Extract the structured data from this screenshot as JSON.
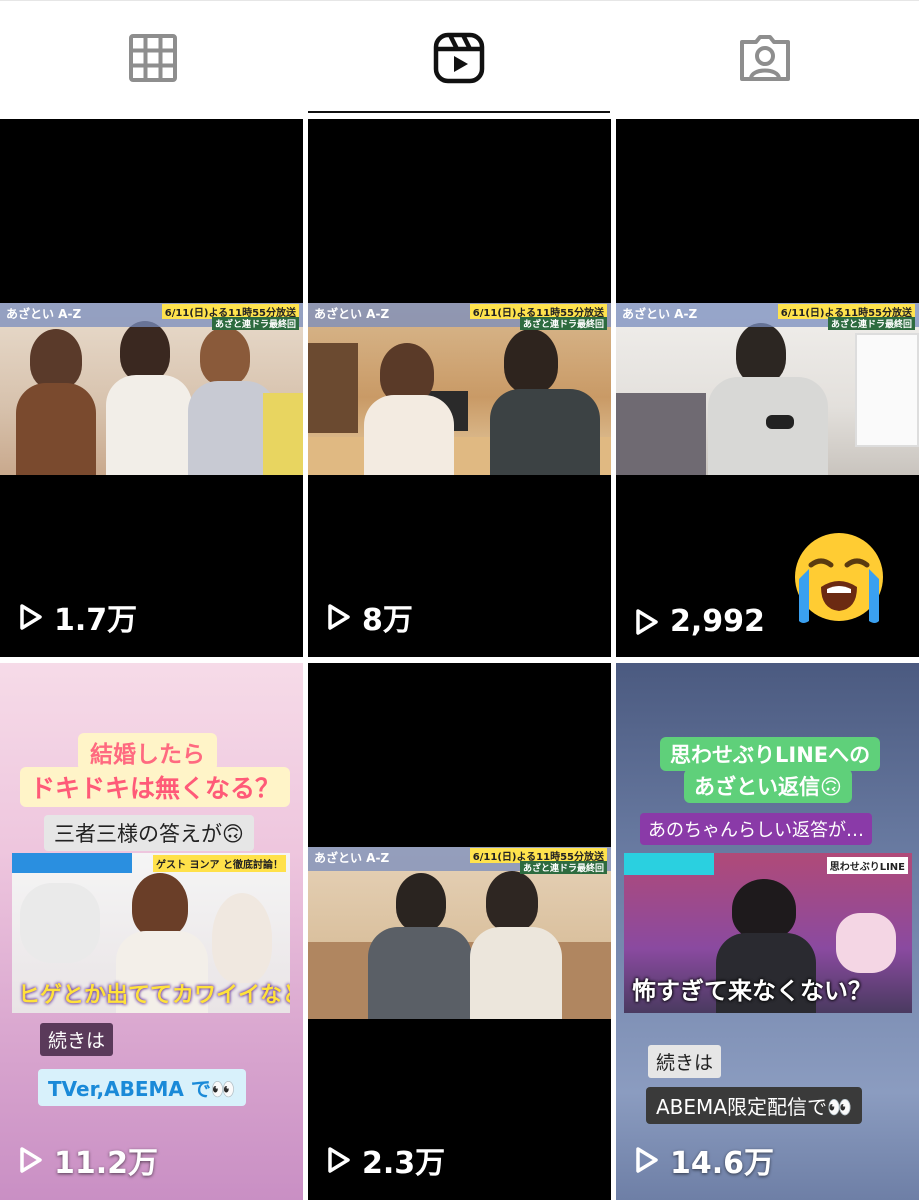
{
  "tabs": [
    {
      "id": "posts",
      "icon": "grid-icon",
      "active": false
    },
    {
      "id": "reels",
      "icon": "reels-icon",
      "active": true
    },
    {
      "id": "tagged",
      "icon": "tagged-person-icon",
      "active": false
    }
  ],
  "reels": [
    {
      "views": "1.7万",
      "banner_left": "あざとい A-Z",
      "banner_right": "6/11(日)よる11時55分放送",
      "banner_sub": "あざと連ドラ最終回"
    },
    {
      "views": "8万",
      "banner_left": "あざとい A-Z",
      "banner_right": "6/11(日)よる11時55分放送",
      "banner_sub": "あざと連ドラ最終回"
    },
    {
      "views": "2,992",
      "banner_left": "あざとい A-Z",
      "banner_right": "6/11(日)よる11時55分放送",
      "banner_sub": "あざと連ドラ最終回",
      "sticker": "loudly-crying-face-emoji"
    },
    {
      "views": "11.2万",
      "title_line1": "結婚したら",
      "title_line2": "ドキドキは無くなる？",
      "subtitle": "三者三様の答えが🙃",
      "tv_caption": "ヒゲとか出ててカワイイなとか",
      "tv_banner": "ゲスト ヨンア と徹底討論！",
      "more_label": "続きは",
      "more_text": "TVer,ABEMA で👀"
    },
    {
      "views": "2.3万",
      "banner_left": "あざとい A-Z",
      "banner_right": "6/11(日)よる11時55分放送",
      "banner_sub": "あざと連ドラ最終回"
    },
    {
      "views": "14.6万",
      "title_line1": "思わせぶりLINEへの",
      "title_line2": "あざとい返信🙃",
      "subtitle": "あのちゃんらしい返答が…",
      "tv_caption": "怖すぎて来なくない？",
      "tv_banner": "思わせぶりLINE",
      "more_label": "続きは",
      "more_text": "ABEMA限定配信で👀"
    }
  ],
  "colors": {
    "active_tab": "#111111",
    "inactive_icon": "#8e8e8e"
  }
}
